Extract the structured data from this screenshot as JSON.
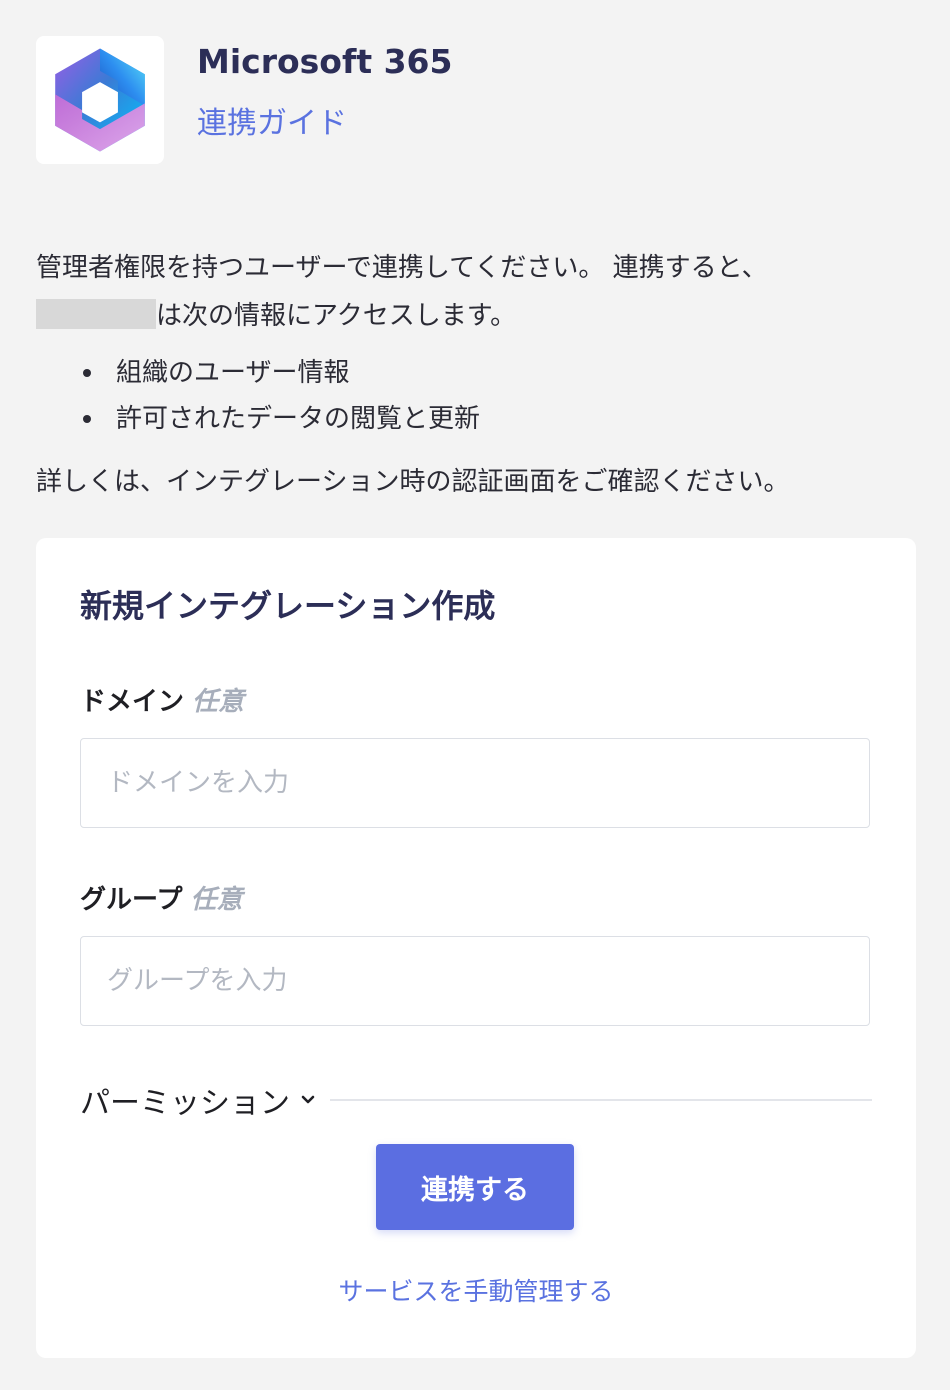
{
  "header": {
    "app_title": "Microsoft 365",
    "guide_link": "連携ガイド",
    "logo_icon": "microsoft-365-logo"
  },
  "intro": {
    "line1": "管理者権限を持つユーザーで連携してください。 連携すると、",
    "line2": "は次の情報にアクセスします。",
    "items": [
      "組織のユーザー情報",
      "許可されたデータの閲覧と更新"
    ],
    "details": "詳しくは、インテグレーション時の認証画面をご確認ください。"
  },
  "form": {
    "title": "新規インテグレーション作成",
    "domain": {
      "label": "ドメイン",
      "optional": "任意",
      "placeholder": "ドメインを入力",
      "value": ""
    },
    "group": {
      "label": "グループ",
      "optional": "任意",
      "placeholder": "グループを入力",
      "value": ""
    },
    "permission_label": "パーミッション",
    "connect_button": "連携する",
    "manual_link": "サービスを手動管理する"
  },
  "colors": {
    "accent": "#5b6ee1",
    "link": "#5a72e0",
    "heading": "#2c2e57",
    "background": "#f3f3f3"
  }
}
